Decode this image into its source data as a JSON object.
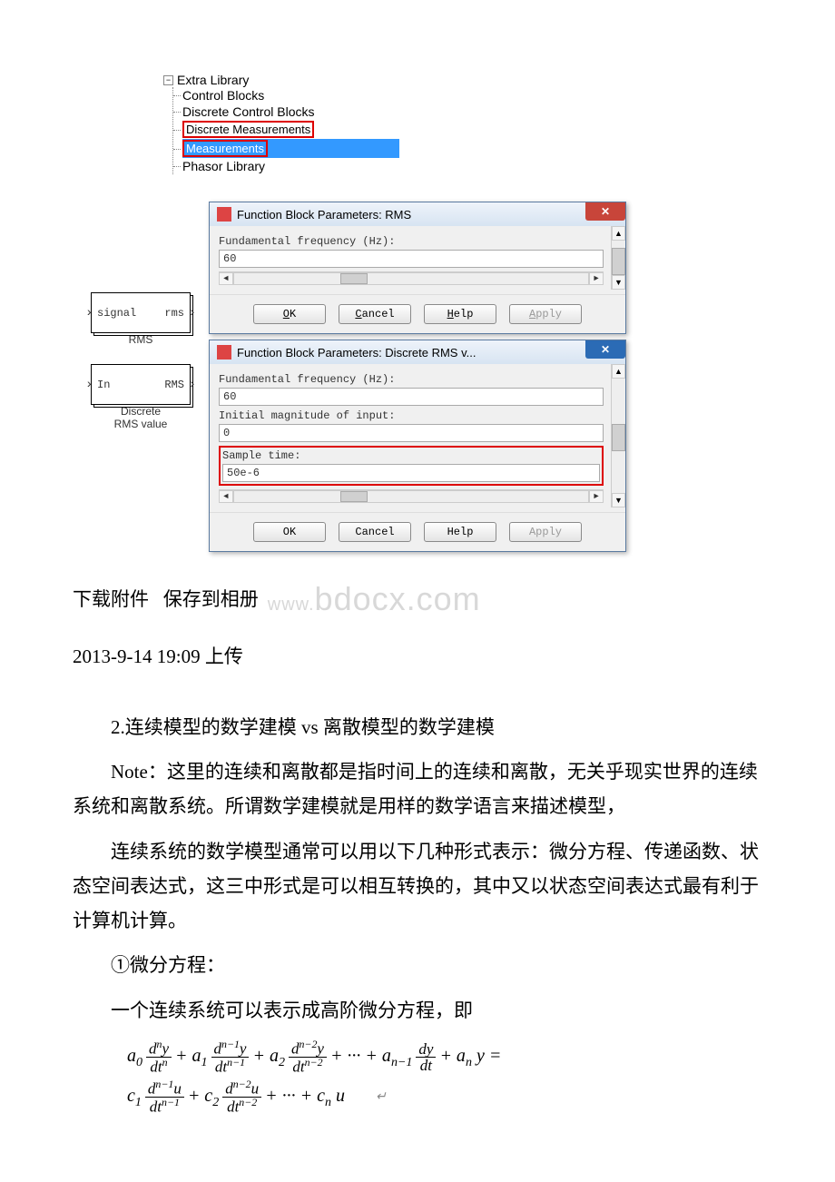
{
  "tree": {
    "root": "Extra Library",
    "items": [
      {
        "label": "Control Blocks"
      },
      {
        "label": "Discrete Control Blocks"
      },
      {
        "label": "Discrete Measurements",
        "boxed": true
      },
      {
        "label": "Measurements",
        "boxed": true,
        "highlighted": true
      },
      {
        "label": "Phasor Library"
      }
    ]
  },
  "blocks": {
    "rms": {
      "left": "signal",
      "right": "rms",
      "label": "RMS"
    },
    "drms": {
      "left": "In",
      "right": "RMS",
      "label": "Discrete\nRMS value"
    }
  },
  "dialog1": {
    "title": "Function Block Parameters: RMS",
    "field1_label": "Fundamental frequency (Hz):",
    "field1_value": "60",
    "buttons": {
      "ok": "OK",
      "cancel": "Cancel",
      "help": "Help",
      "apply": "Apply"
    }
  },
  "dialog2": {
    "title": "Function Block Parameters: Discrete RMS v...",
    "field1_label": "Fundamental frequency (Hz):",
    "field1_value": "60",
    "field2_label": "Initial magnitude of input:",
    "field2_value": "0",
    "field3_label": "Sample time:",
    "field3_value": "50e-6",
    "buttons": {
      "ok": "OK",
      "cancel": "Cancel",
      "help": "Help",
      "apply": "Apply"
    }
  },
  "text": {
    "attach": "下载附件",
    "save": "保存到相册",
    "watermark_pre": "www.",
    "watermark_main": "bdocx.com",
    "timestamp": "2013-9-14 19:09 上传",
    "h2": "2.连续模型的数学建模 vs 离散模型的数学建模",
    "note": "Note：这里的连续和离散都是指时间上的连续和离散，无关乎现实世界的连续系统和离散系统。所谓数学建模就是用样的数学语言来描述模型，",
    "cont_model": "连续系统的数学模型通常可以用以下几种形式表示：微分方程、传递函数、状态空间表达式，这三中形式是可以相互转换的，其中又以状态空间表达式最有利于计算机计算。",
    "diff_label": "①微分方程：",
    "diff_intro": "一个连续系统可以表示成高阶微分方程，即"
  },
  "chart_data": {
    "type": "table",
    "title": "High-order differential equation of a continuous system",
    "equation_text": "a0 * d^n y / dt^n + a1 * d^(n-1) y / dt^(n-1) + a2 * d^(n-2) y / dt^(n-2) + ... + a_(n-1) * dy/dt + a_n * y = c1 * d^(n-1) u / dt^(n-1) + c2 * d^(n-2) u / dt^(n-2) + ... + c_n * u",
    "lhs_coeffs": [
      "a0",
      "a1",
      "a2",
      "...",
      "a_(n-1)",
      "a_n"
    ],
    "lhs_orders": [
      "n",
      "n-1",
      "n-2",
      "...",
      "1",
      "0"
    ],
    "lhs_variable": "y",
    "rhs_coeffs": [
      "c1",
      "c2",
      "...",
      "c_n"
    ],
    "rhs_orders": [
      "n-1",
      "n-2",
      "...",
      "0"
    ],
    "rhs_variable": "u",
    "independent_variable": "t"
  }
}
